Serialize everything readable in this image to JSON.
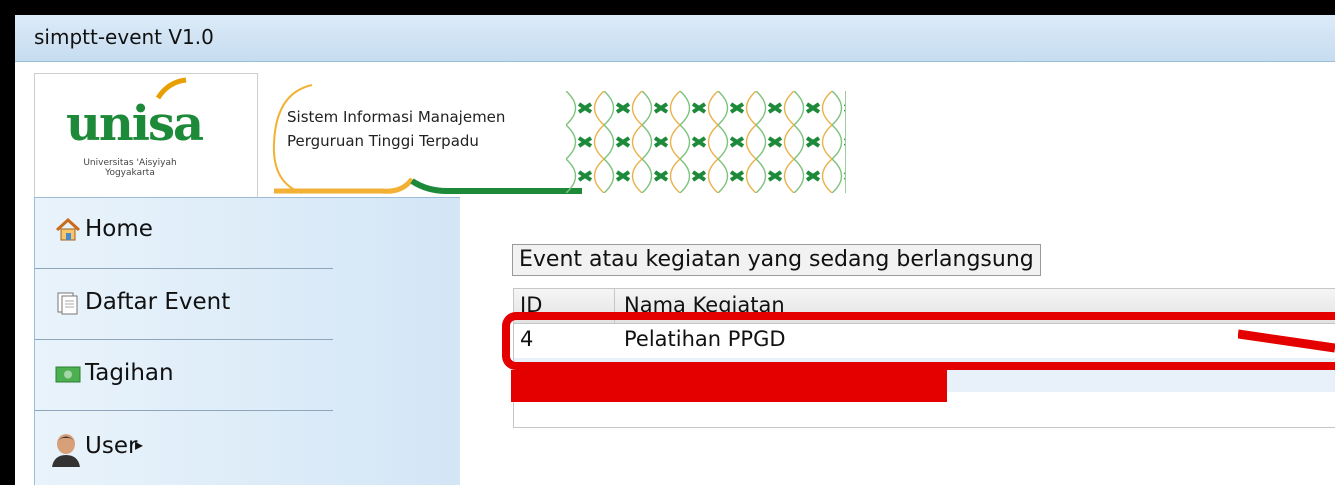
{
  "window": {
    "title": "simptt-event V1.0"
  },
  "header": {
    "logo_text": "unisa",
    "logo_sub_line1": "Universitas 'Aisyiyah",
    "logo_sub_line2": "Yogyakarta",
    "system_line1": "Sistem Informasi Manajemen",
    "system_line2": "Perguruan Tinggi Terpadu"
  },
  "sidebar": {
    "items": [
      {
        "label": "Home",
        "icon": "home-icon"
      },
      {
        "label": "Daftar Event",
        "icon": "document-icon"
      },
      {
        "label": "Tagihan",
        "icon": "money-icon"
      },
      {
        "label": "User",
        "icon": "user-icon",
        "submenu_arrow": "▸"
      }
    ]
  },
  "main": {
    "legend": "Event atau kegiatan yang sedang berlangsung",
    "table": {
      "columns": [
        "ID",
        "Nama Kegiatan"
      ],
      "rows": [
        {
          "id": "4",
          "name": "Pelatihan PPGD"
        }
      ]
    }
  },
  "colors": {
    "accent_red": "#e50000",
    "brand_green": "#1d8a3a",
    "title_bar": "#c6dcf0",
    "sidebar": "#d3e6f6"
  }
}
